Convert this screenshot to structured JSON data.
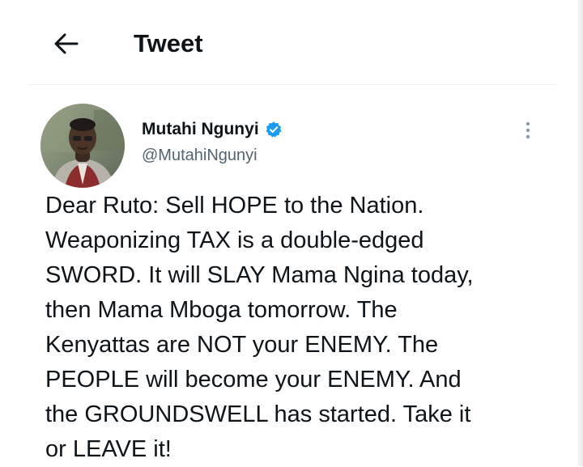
{
  "header": {
    "title": "Tweet",
    "back_icon": "arrow-left-icon"
  },
  "tweet": {
    "author": {
      "display_name": "Mutahi Ngunyi",
      "handle": "@MutahiNgunyi",
      "verified": true,
      "verified_icon": "verified-badge-icon",
      "avatar": "avatar-photo"
    },
    "more_icon": "more-vertical-icon",
    "text_lines": [
      "Dear Ruto: Sell HOPE to the Nation.",
      "Weaponizing TAX is a double-edged",
      "SWORD. It will SLAY Mama Ngina today,",
      "then Mama Mboga tomorrow. The",
      "Kenyattas are NOT your ENEMY. The",
      "PEOPLE will become your ENEMY. And",
      "the GROUNDSWELL has started. Take it",
      "or LEAVE it!"
    ]
  },
  "colors": {
    "text_primary": "#0f1419",
    "text_secondary": "#536471",
    "verified_blue": "#1d9bf0",
    "divider": "#eff3f4"
  }
}
